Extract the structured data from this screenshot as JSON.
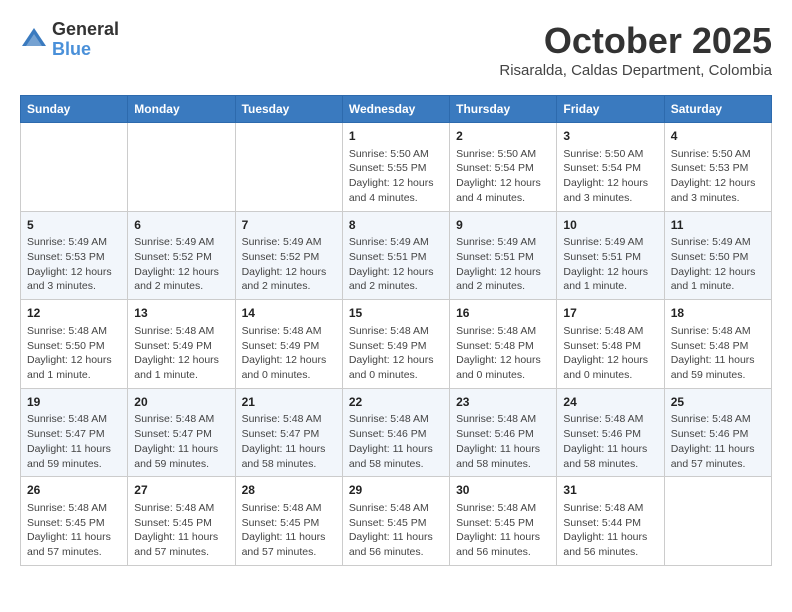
{
  "header": {
    "logo_general": "General",
    "logo_blue": "Blue",
    "month": "October 2025",
    "location": "Risaralda, Caldas Department, Colombia"
  },
  "days_of_week": [
    "Sunday",
    "Monday",
    "Tuesday",
    "Wednesday",
    "Thursday",
    "Friday",
    "Saturday"
  ],
  "weeks": [
    [
      {
        "day": "",
        "sunrise": "",
        "sunset": "",
        "daylight": ""
      },
      {
        "day": "",
        "sunrise": "",
        "sunset": "",
        "daylight": ""
      },
      {
        "day": "",
        "sunrise": "",
        "sunset": "",
        "daylight": ""
      },
      {
        "day": "1",
        "sunrise": "Sunrise: 5:50 AM",
        "sunset": "Sunset: 5:55 PM",
        "daylight": "Daylight: 12 hours and 4 minutes."
      },
      {
        "day": "2",
        "sunrise": "Sunrise: 5:50 AM",
        "sunset": "Sunset: 5:54 PM",
        "daylight": "Daylight: 12 hours and 4 minutes."
      },
      {
        "day": "3",
        "sunrise": "Sunrise: 5:50 AM",
        "sunset": "Sunset: 5:54 PM",
        "daylight": "Daylight: 12 hours and 3 minutes."
      },
      {
        "day": "4",
        "sunrise": "Sunrise: 5:50 AM",
        "sunset": "Sunset: 5:53 PM",
        "daylight": "Daylight: 12 hours and 3 minutes."
      }
    ],
    [
      {
        "day": "5",
        "sunrise": "Sunrise: 5:49 AM",
        "sunset": "Sunset: 5:53 PM",
        "daylight": "Daylight: 12 hours and 3 minutes."
      },
      {
        "day": "6",
        "sunrise": "Sunrise: 5:49 AM",
        "sunset": "Sunset: 5:52 PM",
        "daylight": "Daylight: 12 hours and 2 minutes."
      },
      {
        "day": "7",
        "sunrise": "Sunrise: 5:49 AM",
        "sunset": "Sunset: 5:52 PM",
        "daylight": "Daylight: 12 hours and 2 minutes."
      },
      {
        "day": "8",
        "sunrise": "Sunrise: 5:49 AM",
        "sunset": "Sunset: 5:51 PM",
        "daylight": "Daylight: 12 hours and 2 minutes."
      },
      {
        "day": "9",
        "sunrise": "Sunrise: 5:49 AM",
        "sunset": "Sunset: 5:51 PM",
        "daylight": "Daylight: 12 hours and 2 minutes."
      },
      {
        "day": "10",
        "sunrise": "Sunrise: 5:49 AM",
        "sunset": "Sunset: 5:51 PM",
        "daylight": "Daylight: 12 hours and 1 minute."
      },
      {
        "day": "11",
        "sunrise": "Sunrise: 5:49 AM",
        "sunset": "Sunset: 5:50 PM",
        "daylight": "Daylight: 12 hours and 1 minute."
      }
    ],
    [
      {
        "day": "12",
        "sunrise": "Sunrise: 5:48 AM",
        "sunset": "Sunset: 5:50 PM",
        "daylight": "Daylight: 12 hours and 1 minute."
      },
      {
        "day": "13",
        "sunrise": "Sunrise: 5:48 AM",
        "sunset": "Sunset: 5:49 PM",
        "daylight": "Daylight: 12 hours and 1 minute."
      },
      {
        "day": "14",
        "sunrise": "Sunrise: 5:48 AM",
        "sunset": "Sunset: 5:49 PM",
        "daylight": "Daylight: 12 hours and 0 minutes."
      },
      {
        "day": "15",
        "sunrise": "Sunrise: 5:48 AM",
        "sunset": "Sunset: 5:49 PM",
        "daylight": "Daylight: 12 hours and 0 minutes."
      },
      {
        "day": "16",
        "sunrise": "Sunrise: 5:48 AM",
        "sunset": "Sunset: 5:48 PM",
        "daylight": "Daylight: 12 hours and 0 minutes."
      },
      {
        "day": "17",
        "sunrise": "Sunrise: 5:48 AM",
        "sunset": "Sunset: 5:48 PM",
        "daylight": "Daylight: 12 hours and 0 minutes."
      },
      {
        "day": "18",
        "sunrise": "Sunrise: 5:48 AM",
        "sunset": "Sunset: 5:48 PM",
        "daylight": "Daylight: 11 hours and 59 minutes."
      }
    ],
    [
      {
        "day": "19",
        "sunrise": "Sunrise: 5:48 AM",
        "sunset": "Sunset: 5:47 PM",
        "daylight": "Daylight: 11 hours and 59 minutes."
      },
      {
        "day": "20",
        "sunrise": "Sunrise: 5:48 AM",
        "sunset": "Sunset: 5:47 PM",
        "daylight": "Daylight: 11 hours and 59 minutes."
      },
      {
        "day": "21",
        "sunrise": "Sunrise: 5:48 AM",
        "sunset": "Sunset: 5:47 PM",
        "daylight": "Daylight: 11 hours and 58 minutes."
      },
      {
        "day": "22",
        "sunrise": "Sunrise: 5:48 AM",
        "sunset": "Sunset: 5:46 PM",
        "daylight": "Daylight: 11 hours and 58 minutes."
      },
      {
        "day": "23",
        "sunrise": "Sunrise: 5:48 AM",
        "sunset": "Sunset: 5:46 PM",
        "daylight": "Daylight: 11 hours and 58 minutes."
      },
      {
        "day": "24",
        "sunrise": "Sunrise: 5:48 AM",
        "sunset": "Sunset: 5:46 PM",
        "daylight": "Daylight: 11 hours and 58 minutes."
      },
      {
        "day": "25",
        "sunrise": "Sunrise: 5:48 AM",
        "sunset": "Sunset: 5:46 PM",
        "daylight": "Daylight: 11 hours and 57 minutes."
      }
    ],
    [
      {
        "day": "26",
        "sunrise": "Sunrise: 5:48 AM",
        "sunset": "Sunset: 5:45 PM",
        "daylight": "Daylight: 11 hours and 57 minutes."
      },
      {
        "day": "27",
        "sunrise": "Sunrise: 5:48 AM",
        "sunset": "Sunset: 5:45 PM",
        "daylight": "Daylight: 11 hours and 57 minutes."
      },
      {
        "day": "28",
        "sunrise": "Sunrise: 5:48 AM",
        "sunset": "Sunset: 5:45 PM",
        "daylight": "Daylight: 11 hours and 57 minutes."
      },
      {
        "day": "29",
        "sunrise": "Sunrise: 5:48 AM",
        "sunset": "Sunset: 5:45 PM",
        "daylight": "Daylight: 11 hours and 56 minutes."
      },
      {
        "day": "30",
        "sunrise": "Sunrise: 5:48 AM",
        "sunset": "Sunset: 5:45 PM",
        "daylight": "Daylight: 11 hours and 56 minutes."
      },
      {
        "day": "31",
        "sunrise": "Sunrise: 5:48 AM",
        "sunset": "Sunset: 5:44 PM",
        "daylight": "Daylight: 11 hours and 56 minutes."
      },
      {
        "day": "",
        "sunrise": "",
        "sunset": "",
        "daylight": ""
      }
    ]
  ]
}
